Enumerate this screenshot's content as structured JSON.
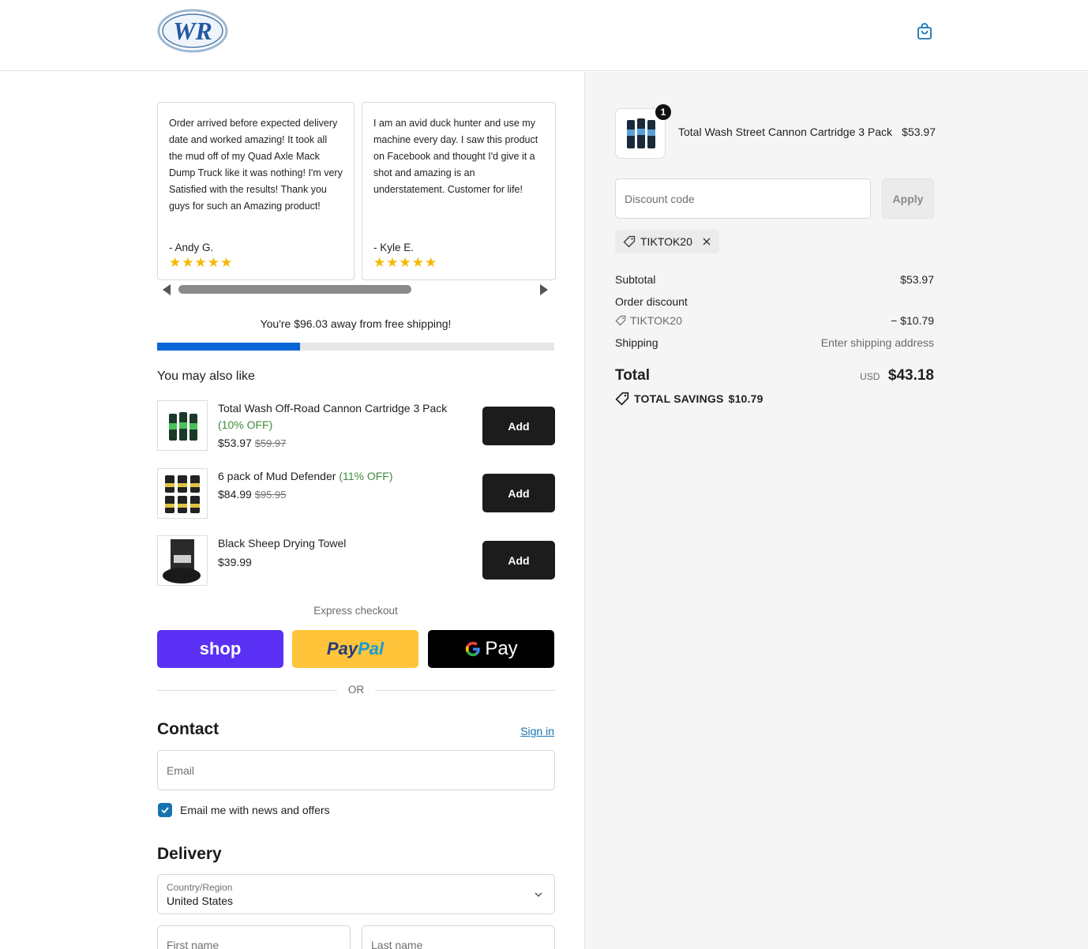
{
  "header": {
    "logo_text": "WR",
    "cart_icon": "shopping-bag-icon"
  },
  "reviews": [
    {
      "text": "Order arrived before expected delivery date and worked amazing! It took all the mud off of my Quad Axle Mack Dump Truck like it was nothing! I'm very Satisfied with the results! Thank you guys for such an Amazing product!",
      "author": "- Andy G.",
      "stars": "★★★★★"
    },
    {
      "text": "I am an avid duck hunter and use my machine every day. I saw this product on Facebook and thought I'd give it a shot and amazing is an understatement. Customer for life!",
      "author": "- Kyle E.",
      "stars": "★★★★★"
    }
  ],
  "shipping_bar": {
    "message": "You're $96.03 away from free shipping!",
    "progress_fraction": 0.36
  },
  "upsells": {
    "title": "You may also like",
    "items": [
      {
        "name": "Total Wash Off-Road Cannon Cartridge 3 Pack",
        "discount": "(10% OFF)",
        "price": "$53.97",
        "compare": "$59.97",
        "button": "Add"
      },
      {
        "name": "6 pack of Mud Defender",
        "discount": "(11% OFF)",
        "price": "$84.99",
        "compare": "$95.95",
        "button": "Add"
      },
      {
        "name": "Black Sheep Drying Towel",
        "discount": "",
        "price": "$39.99",
        "compare": "",
        "button": "Add"
      }
    ]
  },
  "express": {
    "label": "Express checkout",
    "shop": "shop",
    "paypal_1": "Pay",
    "paypal_2": "Pal",
    "gpay": "Pay",
    "or": "OR"
  },
  "contact": {
    "title": "Contact",
    "signin": "Sign in",
    "email_placeholder": "Email",
    "newsletter": "Email me with news and offers"
  },
  "delivery": {
    "title": "Delivery",
    "country_label": "Country/Region",
    "country_value": "United States",
    "first_name": "First name",
    "last_name": "Last name"
  },
  "summary": {
    "item": {
      "qty": "1",
      "name": "Total Wash Street Cannon Cartridge 3 Pack",
      "price": "$53.97"
    },
    "discount_placeholder": "Discount code",
    "apply": "Apply",
    "applied_code": "TIKTOK20",
    "subtotal_label": "Subtotal",
    "subtotal": "$53.97",
    "order_discount_label": "Order discount",
    "order_discount_code": "TIKTOK20",
    "order_discount": "− $10.79",
    "shipping_label": "Shipping",
    "shipping": "Enter shipping address",
    "total_label": "Total",
    "currency": "USD",
    "total": "$43.18",
    "savings_label": "TOTAL SAVINGS",
    "savings": "$10.79"
  },
  "colors": {
    "accent": "#1773b0",
    "progress": "#0a66d6",
    "shop_pay": "#5a31f4",
    "paypal": "#ffc439",
    "discount_green": "#3d8b3d"
  }
}
